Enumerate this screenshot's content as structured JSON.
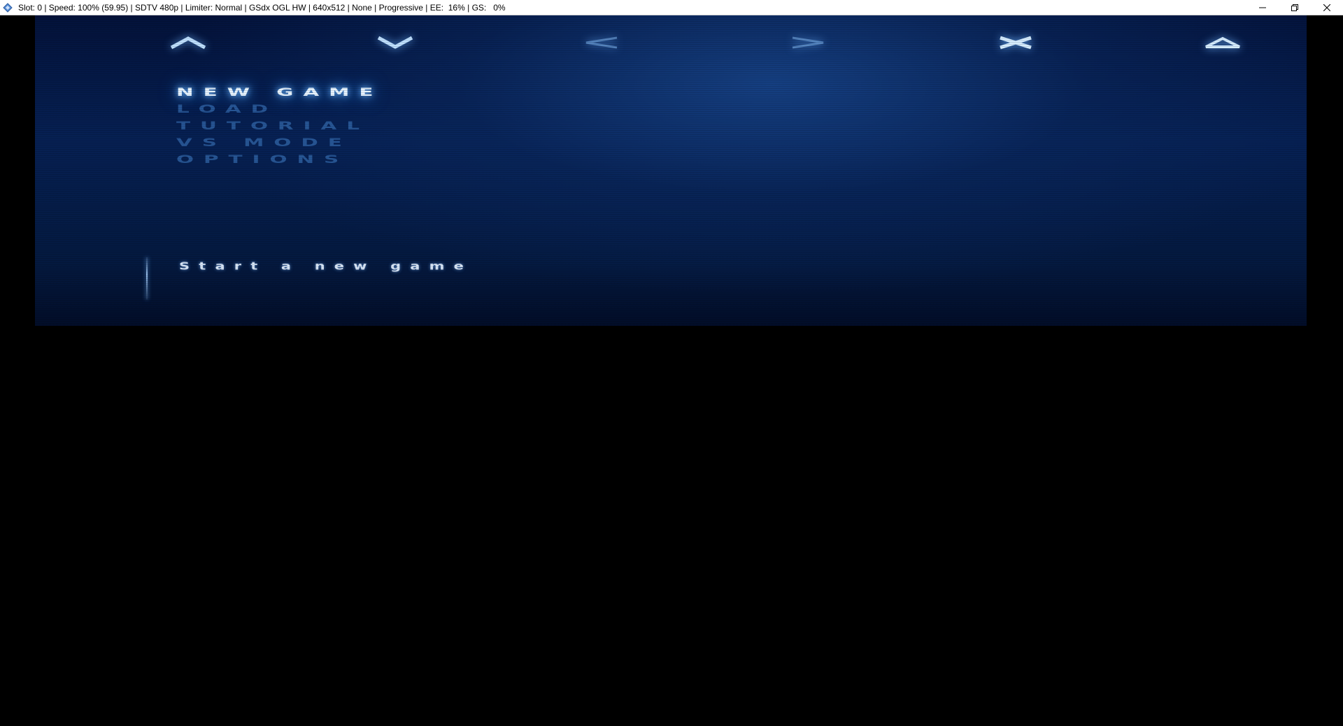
{
  "window": {
    "title": "Slot: 0 | Speed: 100% (59.95) | SDTV 480p | Limiter: Normal | GSdx OGL HW | 640x512 | None | Progressive | EE:  16% | GS:   0%",
    "icon": "pcsx2-icon",
    "controls": [
      "minimize-icon",
      "restore-icon",
      "close-icon"
    ]
  },
  "game": {
    "button_hints": [
      {
        "name": "up",
        "symbol": "up-arrow"
      },
      {
        "name": "down",
        "symbol": "down-arrow"
      },
      {
        "name": "left",
        "symbol": "left-arrow"
      },
      {
        "name": "right",
        "symbol": "right-arrow"
      },
      {
        "name": "cross",
        "symbol": "cross"
      },
      {
        "name": "triangle",
        "symbol": "triangle"
      }
    ],
    "menu": {
      "items": [
        "NEW GAME",
        "LOAD",
        "TUTORIAL",
        "VS MODE",
        "OPTIONS"
      ],
      "selected": "NEW GAME"
    },
    "description": "Start a new game",
    "colors": {
      "glow": "#6fb8ff",
      "selected_text": "#e6f3ff",
      "dim_text": "#5096e6"
    }
  }
}
